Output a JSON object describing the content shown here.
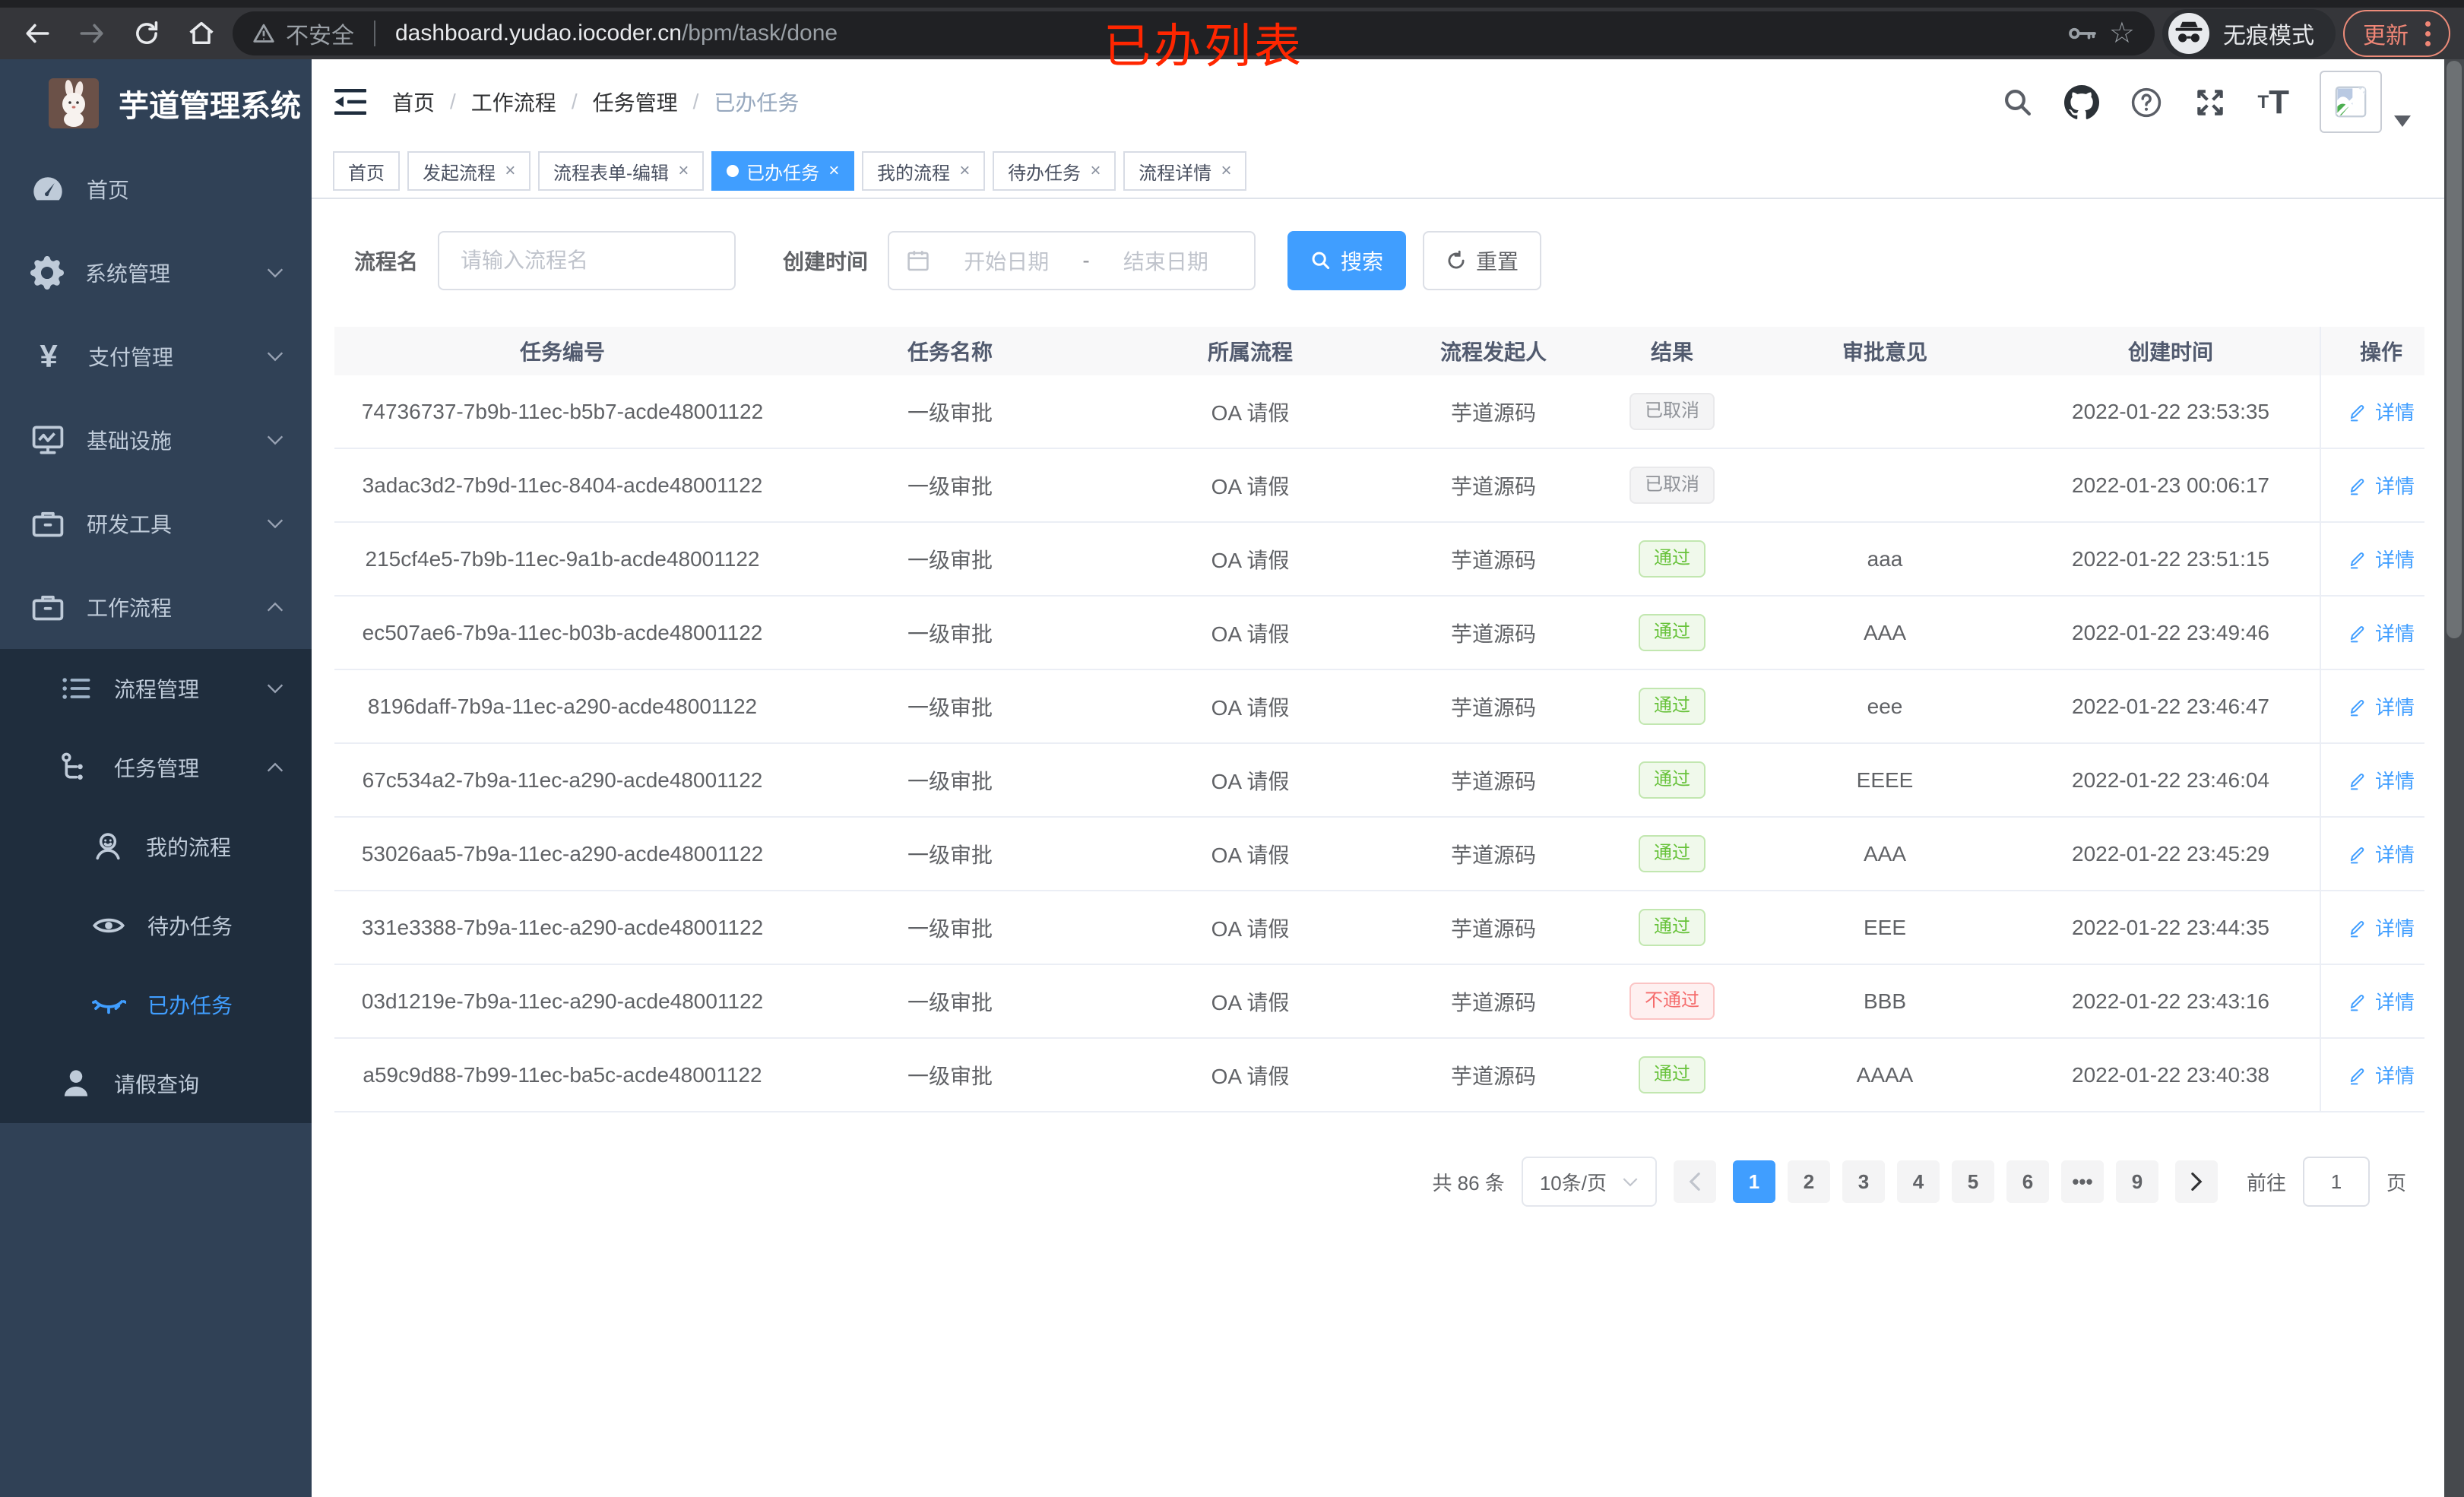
{
  "chrome": {
    "security_label": "不安全",
    "url_host": "dashboard.yudao.iocoder.cn",
    "url_path": "/bpm/task/done",
    "incognito_label": "无痕模式",
    "update_label": "更新"
  },
  "annotation": {
    "text": "已办列表",
    "color": "#ff2600"
  },
  "sidebar": {
    "title": "芋道管理系统",
    "items": [
      {
        "label": "首页",
        "icon": "dashboard-icon"
      },
      {
        "label": "系统管理",
        "icon": "gear-icon",
        "chevron": "down"
      },
      {
        "label": "支付管理",
        "icon": "yen-icon",
        "chevron": "down"
      },
      {
        "label": "基础设施",
        "icon": "monitor-icon",
        "chevron": "down"
      },
      {
        "label": "研发工具",
        "icon": "toolbox-icon",
        "chevron": "down"
      },
      {
        "label": "工作流程",
        "icon": "briefcase-icon",
        "chevron": "up"
      },
      {
        "label": "流程管理",
        "icon": "tree-list-icon",
        "chevron": "down"
      },
      {
        "label": "任务管理",
        "icon": "flow-icon",
        "chevron": "up"
      },
      {
        "label": "我的流程",
        "icon": "person-face-icon"
      },
      {
        "label": "待办任务",
        "icon": "eye-open-icon"
      },
      {
        "label": "已办任务",
        "icon": "eye-closed-icon",
        "active": true
      },
      {
        "label": "请假查询",
        "icon": "user-icon"
      }
    ]
  },
  "header": {
    "breadcrumb": [
      "首页",
      "工作流程",
      "任务管理",
      "已办任务"
    ]
  },
  "tabs": [
    {
      "label": "首页",
      "closable": false,
      "active": false
    },
    {
      "label": "发起流程",
      "closable": true,
      "active": false
    },
    {
      "label": "流程表单-编辑",
      "closable": true,
      "active": false
    },
    {
      "label": "已办任务",
      "closable": true,
      "active": true
    },
    {
      "label": "我的流程",
      "closable": true,
      "active": false
    },
    {
      "label": "待办任务",
      "closable": true,
      "active": false
    },
    {
      "label": "流程详情",
      "closable": true,
      "active": false
    }
  ],
  "search": {
    "name_label": "流程名",
    "name_placeholder": "请输入流程名",
    "time_label": "创建时间",
    "start_placeholder": "开始日期",
    "range_separator": "-",
    "end_placeholder": "结束日期",
    "search_button": "搜索",
    "reset_button": "重置"
  },
  "table": {
    "headers": [
      "任务编号",
      "任务名称",
      "所属流程",
      "流程发起人",
      "结果",
      "审批意见",
      "创建时间",
      "操作"
    ],
    "rows": [
      {
        "id": "74736737-7b9b-11ec-b5b7-acde48001122",
        "name": "一级审批",
        "process": "OA 请假",
        "starter": "芋道源码",
        "result": "已取消",
        "result_type": "info",
        "comment": "",
        "created": "2022-01-22 23:53:35",
        "action": "详情"
      },
      {
        "id": "3adac3d2-7b9d-11ec-8404-acde48001122",
        "name": "一级审批",
        "process": "OA 请假",
        "starter": "芋道源码",
        "result": "已取消",
        "result_type": "info",
        "comment": "",
        "created": "2022-01-23 00:06:17",
        "action": "详情"
      },
      {
        "id": "215cf4e5-7b9b-11ec-9a1b-acde48001122",
        "name": "一级审批",
        "process": "OA 请假",
        "starter": "芋道源码",
        "result": "通过",
        "result_type": "success",
        "comment": "aaa",
        "created": "2022-01-22 23:51:15",
        "action": "详情"
      },
      {
        "id": "ec507ae6-7b9a-11ec-b03b-acde48001122",
        "name": "一级审批",
        "process": "OA 请假",
        "starter": "芋道源码",
        "result": "通过",
        "result_type": "success",
        "comment": "AAA",
        "created": "2022-01-22 23:49:46",
        "action": "详情"
      },
      {
        "id": "8196daff-7b9a-11ec-a290-acde48001122",
        "name": "一级审批",
        "process": "OA 请假",
        "starter": "芋道源码",
        "result": "通过",
        "result_type": "success",
        "comment": "eee",
        "created": "2022-01-22 23:46:47",
        "action": "详情"
      },
      {
        "id": "67c534a2-7b9a-11ec-a290-acde48001122",
        "name": "一级审批",
        "process": "OA 请假",
        "starter": "芋道源码",
        "result": "通过",
        "result_type": "success",
        "comment": "EEEE",
        "created": "2022-01-22 23:46:04",
        "action": "详情"
      },
      {
        "id": "53026aa5-7b9a-11ec-a290-acde48001122",
        "name": "一级审批",
        "process": "OA 请假",
        "starter": "芋道源码",
        "result": "通过",
        "result_type": "success",
        "comment": "AAA",
        "created": "2022-01-22 23:45:29",
        "action": "详情"
      },
      {
        "id": "331e3388-7b9a-11ec-a290-acde48001122",
        "name": "一级审批",
        "process": "OA 请假",
        "starter": "芋道源码",
        "result": "通过",
        "result_type": "success",
        "comment": "EEE",
        "created": "2022-01-22 23:44:35",
        "action": "详情"
      },
      {
        "id": "03d1219e-7b9a-11ec-a290-acde48001122",
        "name": "一级审批",
        "process": "OA 请假",
        "starter": "芋道源码",
        "result": "不通过",
        "result_type": "danger",
        "comment": "BBB",
        "created": "2022-01-22 23:43:16",
        "action": "详情"
      },
      {
        "id": "a59c9d88-7b99-11ec-ba5c-acde48001122",
        "name": "一级审批",
        "process": "OA 请假",
        "starter": "芋道源码",
        "result": "通过",
        "result_type": "success",
        "comment": "AAAA",
        "created": "2022-01-22 23:40:38",
        "action": "详情"
      }
    ]
  },
  "pagination": {
    "total": "共 86 条",
    "page_size": "10条/页",
    "pages": [
      "1",
      "2",
      "3",
      "4",
      "5",
      "6",
      "•••",
      "9"
    ],
    "active_page": "1",
    "goto_label": "前往",
    "goto_value": "1",
    "unit": "页"
  },
  "colors": {
    "accent": "#409eff",
    "success": "#67c23a",
    "danger": "#f56c6c",
    "info": "#909399",
    "sidebar_bg": "#304156",
    "submenu_bg": "#1f2d3d",
    "annotation_red": "#ff2600"
  }
}
